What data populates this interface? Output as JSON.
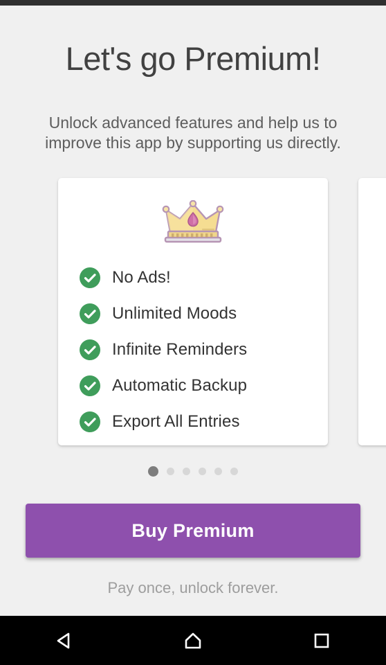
{
  "app": {
    "background_color": "#f0f0f0",
    "accent_color": "#8e50ad",
    "check_color": "#3f9d5b"
  },
  "header": {
    "title": "Let's go Premium!",
    "subtitle": "Unlock advanced features and help us to improve this app by supporting us directly."
  },
  "carousel": {
    "card": {
      "icon": "crown-icon",
      "features": [
        {
          "icon": "check-circle-icon",
          "label": "No Ads!"
        },
        {
          "icon": "check-circle-icon",
          "label": "Unlimited Moods"
        },
        {
          "icon": "check-circle-icon",
          "label": "Infinite Reminders"
        },
        {
          "icon": "check-circle-icon",
          "label": "Automatic Backup"
        },
        {
          "icon": "check-circle-icon",
          "label": "Export All Entries"
        }
      ]
    },
    "pagination": {
      "total": 6,
      "active_index": 0
    }
  },
  "cta": {
    "buy_label": "Buy Premium",
    "footer_note": "Pay once, unlock forever."
  },
  "navbar": {
    "back": "back-triangle-icon",
    "home": "home-icon",
    "recents": "recents-square-icon"
  }
}
